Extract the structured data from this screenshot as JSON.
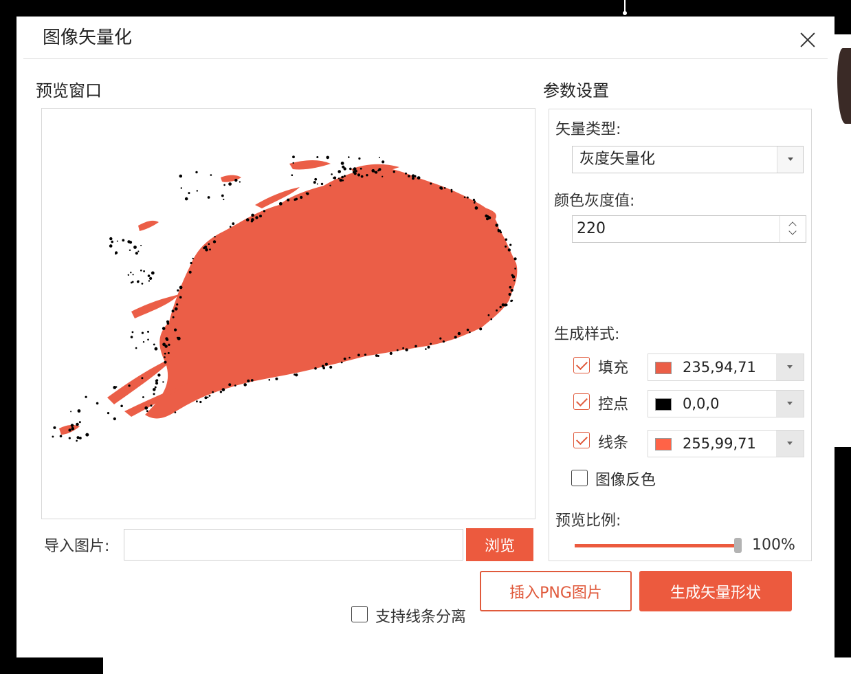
{
  "dialog": {
    "title": "图像矢量化"
  },
  "preview": {
    "title": "预览窗口",
    "shape_fill_color": "#EB5E47",
    "control_point_color": "#000000"
  },
  "import": {
    "label": "导入图片:",
    "value": "",
    "browse_label": "浏览"
  },
  "params": {
    "title": "参数设置",
    "vector_type_label": "矢量类型:",
    "vector_type_value": "灰度矢量化",
    "gray_value_label": "颜色灰度值:",
    "gray_value": "220",
    "style_label": "生成样式:",
    "styles": [
      {
        "label": "填充",
        "checked": true,
        "color_text": "235,94,71",
        "swatch": "#EB5E47"
      },
      {
        "label": "控点",
        "checked": true,
        "color_text": "0,0,0",
        "swatch": "#000000"
      },
      {
        "label": "线条",
        "checked": true,
        "color_text": "255,99,71",
        "swatch": "#FF6347"
      }
    ],
    "invert_label": "图像反色",
    "invert_checked": false,
    "scale_label": "预览比例:",
    "scale_value": "100%",
    "scale_fraction": 1.0
  },
  "footer": {
    "split_label": "支持线条分离",
    "split_checked": false,
    "insert_png_label": "插入PNG图片",
    "generate_label": "生成矢量形状"
  },
  "colors": {
    "accent": "#EC5A3E",
    "accent_border": "#E05A3C"
  }
}
